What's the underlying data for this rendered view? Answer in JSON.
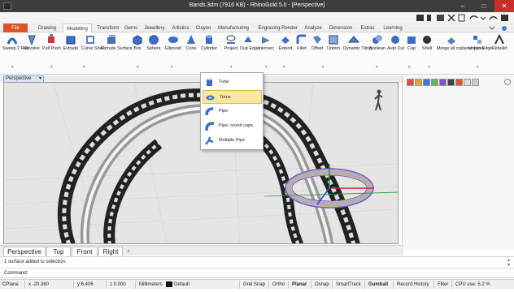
{
  "window": {
    "title": "Bands.3dm (7916 KB) - RhinoGold 5.0 - [Perspective]",
    "minimize_glyph": "–",
    "maximize_glyph": "□",
    "close_glyph": "✕"
  },
  "tabs": [
    "File",
    "Drawing",
    "Modelling",
    "Transform",
    "Gems",
    "Jewellery",
    "Artistics",
    "Clayoo",
    "Manufacturing",
    "Engraving",
    "Render",
    "Analyze",
    "Dimension",
    "Extras",
    "Learning"
  ],
  "active_tab": "Modelling",
  "ribbon": {
    "sweep_label": "Sweep 2 Rail",
    "revolve_label": "Revolve",
    "pull_push_label": "Pull Push",
    "extrude_label": "Extrude",
    "curve_shell_label": "Curve Shell",
    "extrude_surface_label": "Extrude Surface",
    "box_label": "Box",
    "sphere_label": "Sphere",
    "ellipsoid_label": "Ellipsoid",
    "cone_label": "Cone",
    "cylinder_label": "Cylinder",
    "project_label": "Project",
    "dup_edge_label": "Dup Edge",
    "intersec_label": "Intersec",
    "extend_label": "Extend",
    "fillet_label": "Fillet",
    "offset_label": "Offset",
    "untrim_label": "Untrim",
    "dynamic_tiling_label": "Dynamic Tiling",
    "boolean_label": "Boolean",
    "auto_cut_label": "Auto Cut",
    "cap_label": "Cap",
    "shell_label": "Shell",
    "merge_coplanar_label": "Merge all coplanar faces",
    "unjoin_edge_label": "Unjoin Edge",
    "rebuild_label": "Rebuild"
  },
  "dropdown": {
    "items": [
      "Tube",
      "Torus",
      "Pipe",
      "Pipe, round caps",
      "Multiple Pipe"
    ],
    "highlighted": "Torus"
  },
  "viewport": {
    "active_name": "Perspective",
    "tabs": [
      "Perspective",
      "Top",
      "Front",
      "Right"
    ],
    "add_glyph": "+"
  },
  "history": {
    "text": "1 surface added to selection."
  },
  "command": {
    "label": "Command:",
    "value": ""
  },
  "status": {
    "cplane": "CPlane",
    "x": "x -20.360",
    "y": "y 6.406",
    "z": "z 0.000",
    "units": "Millimeters",
    "layer": "Default",
    "grid_snap": "Grid Snap",
    "ortho": "Ortho",
    "planar": "Planar",
    "osnap": "Osnap",
    "smarttrack": "SmartTrack",
    "gumball": "Gumball",
    "record_history": "Record History",
    "filter": "Filter",
    "cpu": "CPU use: 5.2 %"
  },
  "colors": {
    "titlebar": "#3d3d3d",
    "file_tab": "#d9552a",
    "close_button": "#c9302c",
    "highlight": "#fbe7a2",
    "gumball_ring": "#8a4fd1"
  }
}
